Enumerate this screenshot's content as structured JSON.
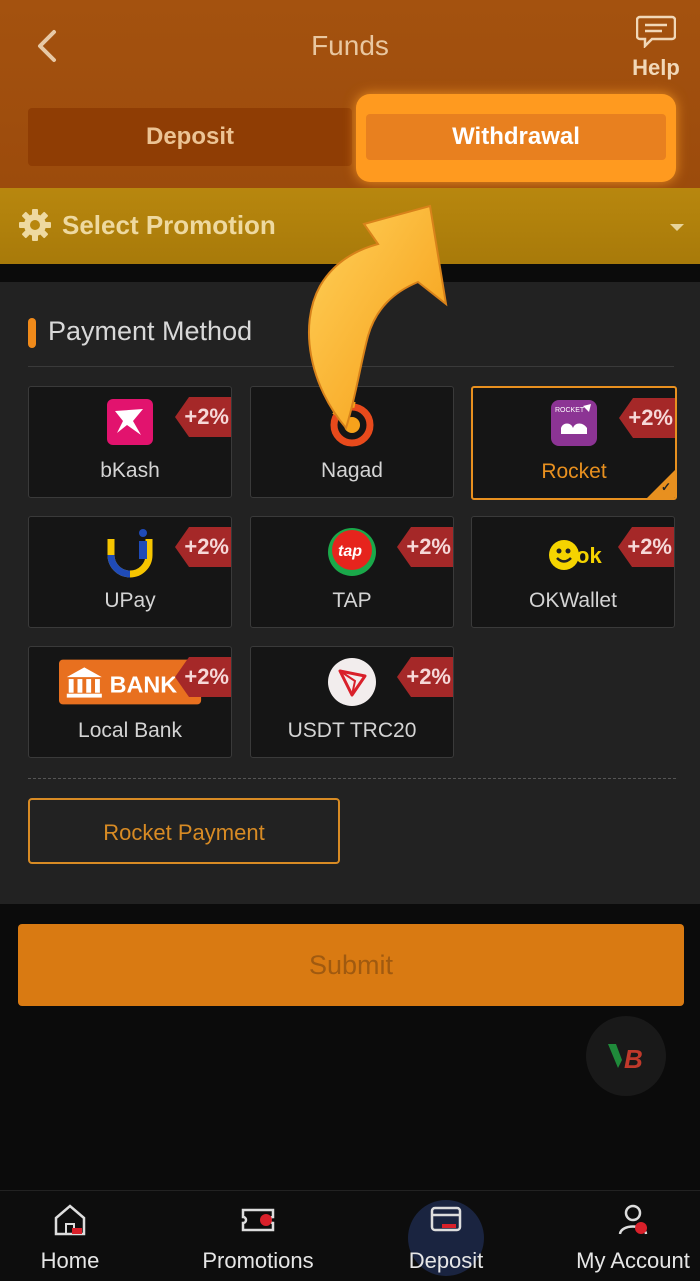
{
  "header": {
    "title": "Funds",
    "help_label": "Help",
    "tabs": [
      {
        "label": "Deposit",
        "active": false
      },
      {
        "label": "Withdrawal",
        "active": true
      }
    ]
  },
  "promotion": {
    "label": "Select Promotion"
  },
  "payment": {
    "section_title": "Payment Method",
    "methods": [
      {
        "name": "bKash",
        "bonus": "+2%",
        "selected": false,
        "icon": "bkash-icon"
      },
      {
        "name": "Nagad",
        "bonus": "",
        "selected": false,
        "icon": "nagad-icon"
      },
      {
        "name": "Rocket",
        "bonus": "+2%",
        "selected": true,
        "icon": "rocket-icon"
      },
      {
        "name": "UPay",
        "bonus": "+2%",
        "selected": false,
        "icon": "upay-icon"
      },
      {
        "name": "TAP",
        "bonus": "+2%",
        "selected": false,
        "icon": "tap-icon"
      },
      {
        "name": "OKWallet",
        "bonus": "+2%",
        "selected": false,
        "icon": "okwallet-icon"
      },
      {
        "name": "Local Bank",
        "bonus": "+2%",
        "selected": false,
        "icon": "bank-icon"
      },
      {
        "name": "USDT TRC20",
        "bonus": "+2%",
        "selected": false,
        "icon": "tron-icon"
      }
    ],
    "bank_logo_text": "BANK",
    "tap_logo_text": "tap",
    "rocket_logo_text": "ROCKET",
    "okwallet_logo_text": "ok",
    "option_label": "Rocket Payment"
  },
  "submit_label": "Submit",
  "nav": {
    "items": [
      {
        "label": "Home",
        "icon": "home-icon",
        "active": false
      },
      {
        "label": "Promotions",
        "icon": "ticket-icon",
        "active": false
      },
      {
        "label": "Deposit",
        "icon": "wallet-icon",
        "active": true
      },
      {
        "label": "My Account",
        "icon": "account-icon",
        "active": false
      }
    ]
  },
  "colors": {
    "accent": "#e8901f",
    "header": "#a4520f",
    "promotion_bar": "#b8870e",
    "badge": "#a52828"
  }
}
